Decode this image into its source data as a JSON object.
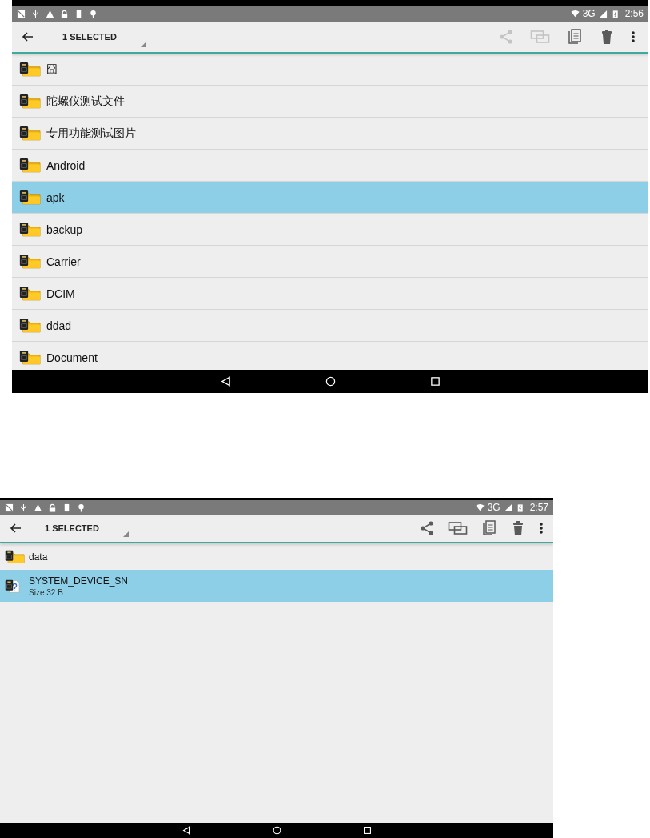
{
  "screens": [
    {
      "status_bar": {
        "network": "3G",
        "time": "2:56"
      },
      "toolbar": {
        "title": "1 SELECTED",
        "actions": [
          {
            "kind": "share",
            "disabled": true
          },
          {
            "kind": "move",
            "disabled": true
          },
          {
            "kind": "copy",
            "disabled": false
          },
          {
            "kind": "delete",
            "disabled": false
          },
          {
            "kind": "more",
            "disabled": false
          }
        ]
      },
      "rows": [
        {
          "kind": "folder",
          "name": "囧",
          "selected": false
        },
        {
          "kind": "folder",
          "name": "陀螺仪测试文件",
          "selected": false
        },
        {
          "kind": "folder",
          "name": "专用功能测试图片",
          "selected": false
        },
        {
          "kind": "folder",
          "name": "Android",
          "selected": false
        },
        {
          "kind": "folder",
          "name": "apk",
          "selected": true
        },
        {
          "kind": "folder",
          "name": "backup",
          "selected": false
        },
        {
          "kind": "folder",
          "name": "Carrier",
          "selected": false
        },
        {
          "kind": "folder",
          "name": "DCIM",
          "selected": false
        },
        {
          "kind": "folder",
          "name": "ddad",
          "selected": false
        },
        {
          "kind": "folder",
          "name": "Document",
          "selected": false
        }
      ]
    },
    {
      "status_bar": {
        "network": "3G",
        "time": "2:57"
      },
      "toolbar": {
        "title": "1 SELECTED",
        "actions": [
          {
            "kind": "share",
            "disabled": false
          },
          {
            "kind": "move",
            "disabled": false
          },
          {
            "kind": "copy",
            "disabled": false
          },
          {
            "kind": "delete",
            "disabled": false
          },
          {
            "kind": "more",
            "disabled": false
          }
        ]
      },
      "rows": [
        {
          "kind": "folder",
          "name": "data",
          "selected": false
        },
        {
          "kind": "file",
          "name": "SYSTEM_DEVICE_SN",
          "detail": "Size 32 B",
          "selected": true
        }
      ]
    }
  ]
}
